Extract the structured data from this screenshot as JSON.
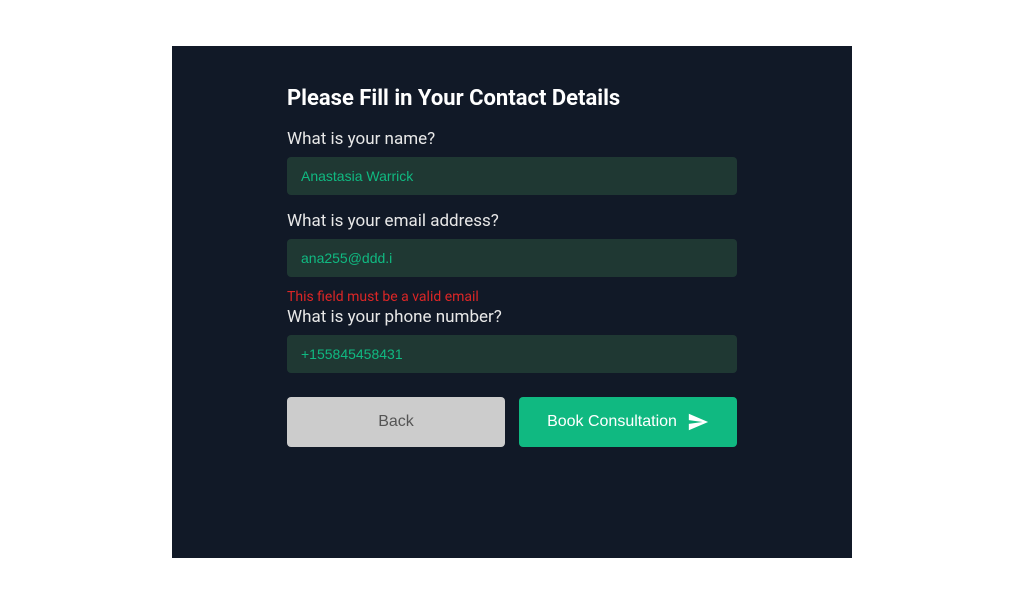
{
  "form": {
    "title": "Please Fill in Your Contact Details",
    "name": {
      "label": "What is your name?",
      "value": "Anastasia Warrick"
    },
    "email": {
      "label": "What is your email address?",
      "value": "ana255@ddd.i",
      "error": "This field must be a valid email"
    },
    "phone": {
      "label": "What is your phone number?",
      "value": "+155845458431"
    },
    "buttons": {
      "back": "Back",
      "submit": "Book Consultation"
    }
  }
}
